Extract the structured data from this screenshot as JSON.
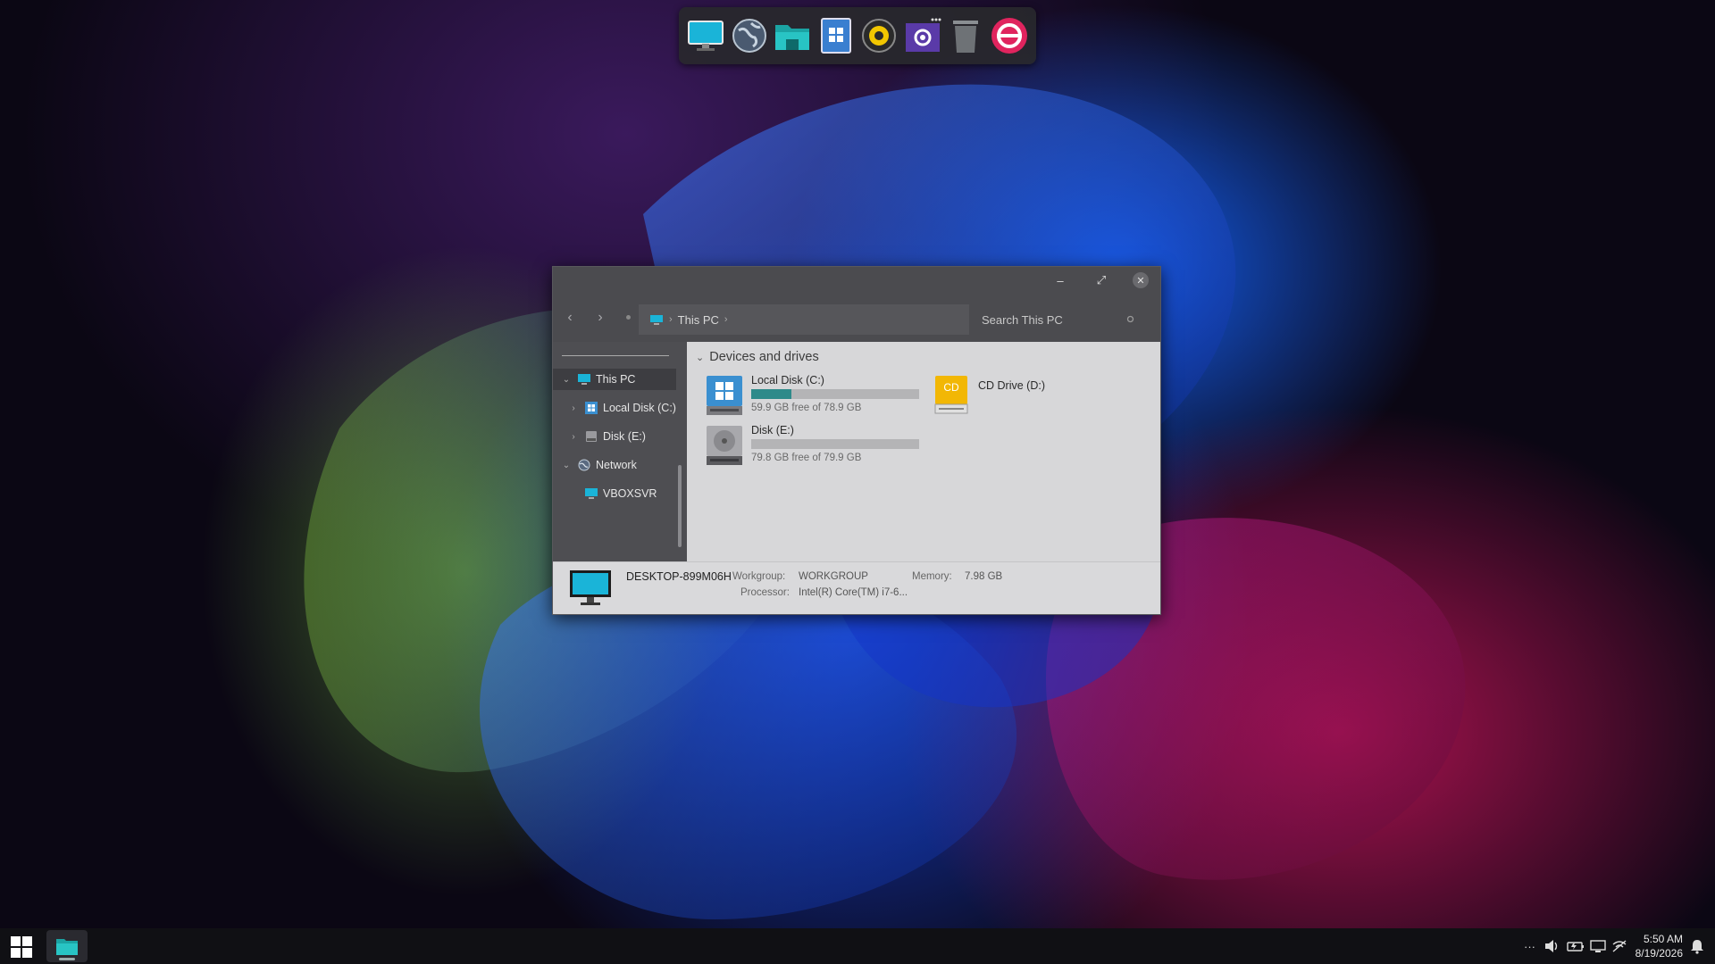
{
  "dock": {
    "items": [
      "monitor-icon",
      "globe-icon",
      "folder-icon",
      "windows-store-icon",
      "audio-player-icon",
      "settings-icon",
      "trash-icon",
      "refresh-app-icon"
    ]
  },
  "window": {
    "breadcrumb": "This PC",
    "search_placeholder": "Search This PC",
    "sidebar": {
      "items": [
        {
          "label": "This PC"
        },
        {
          "label": "Local Disk (C:)"
        },
        {
          "label": "Disk (E:)"
        },
        {
          "label": "Network"
        },
        {
          "label": "VBOXSVR"
        }
      ]
    },
    "group_title": "Devices and drives",
    "drives": [
      {
        "name": "Local Disk (C:)",
        "free": "59.9 GB free of 78.9 GB",
        "used_fraction": 0.24
      },
      {
        "name": "Disk (E:)",
        "free": "79.8 GB free of 79.9 GB",
        "used_fraction": 0.0
      },
      {
        "name": "CD Drive (D:)",
        "badge": "CD"
      }
    ],
    "status": {
      "computer_name": "DESKTOP-899M06H",
      "workgroup_label": "Workgroup:",
      "workgroup_value": "WORKGROUP",
      "memory_label": "Memory:",
      "memory_value": "7.98 GB",
      "processor_label": "Processor:",
      "processor_value": "Intel(R) Core(TM) i7-6..."
    }
  },
  "taskbar": {
    "tray_more": "···",
    "time": "5:50 AM",
    "date": "8/19/2026"
  },
  "colors": {
    "accent_teal": "#2e8a8a",
    "cd_yellow": "#f2b705"
  }
}
